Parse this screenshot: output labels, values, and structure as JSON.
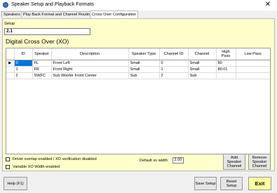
{
  "window": {
    "title": "Speaker Setup and Playback Formats",
    "close_glyph": "✕"
  },
  "tabs": [
    {
      "label": "Speakers"
    },
    {
      "label": "Play Back Format and Channel Routing"
    },
    {
      "label": "Cross Over Configuration"
    }
  ],
  "setup": {
    "label": "Setup",
    "value": "2.1"
  },
  "heading": "Digital Cross Over (XO)",
  "table": {
    "columns": [
      "ID",
      "Speaker",
      "Description",
      "Speaker Type",
      "Channel ID",
      "Channel",
      "High Pass",
      "Low Pass"
    ],
    "rows": [
      {
        "indicator": "▶",
        "cells": [
          "0",
          "FL",
          "Front Left",
          "Small",
          "0",
          "Small",
          "80",
          ""
        ]
      },
      {
        "indicator": "",
        "cells": [
          "1",
          "FR",
          "Front Right",
          "Small",
          "1",
          "Small",
          "80.01",
          ""
        ]
      },
      {
        "indicator": "",
        "cells": [
          "2",
          "SWFC",
          "Sub Woofer Front Center",
          "Sub",
          "2",
          "Sub",
          "",
          ""
        ]
      }
    ]
  },
  "options": {
    "driver_overlap_label": "Driver overlap enabled / XO verification disabled",
    "variable_xo_label": "Variable XO Width enabled"
  },
  "xo_width": {
    "label": "Default xo width:",
    "value": "2.00"
  },
  "buttons": {
    "add_speaker_channel": "Add Speaker Channel",
    "remove_speaker_channel": "Remove Speaker Channel",
    "help": "Help (F1)",
    "save_setup": "Save Setup",
    "reset_setup": "Reset Setup",
    "exit": "Exit"
  },
  "colors": {
    "panel": "#ffffcc",
    "selection": "#0078d7",
    "exit_button": "#ffff9e"
  }
}
